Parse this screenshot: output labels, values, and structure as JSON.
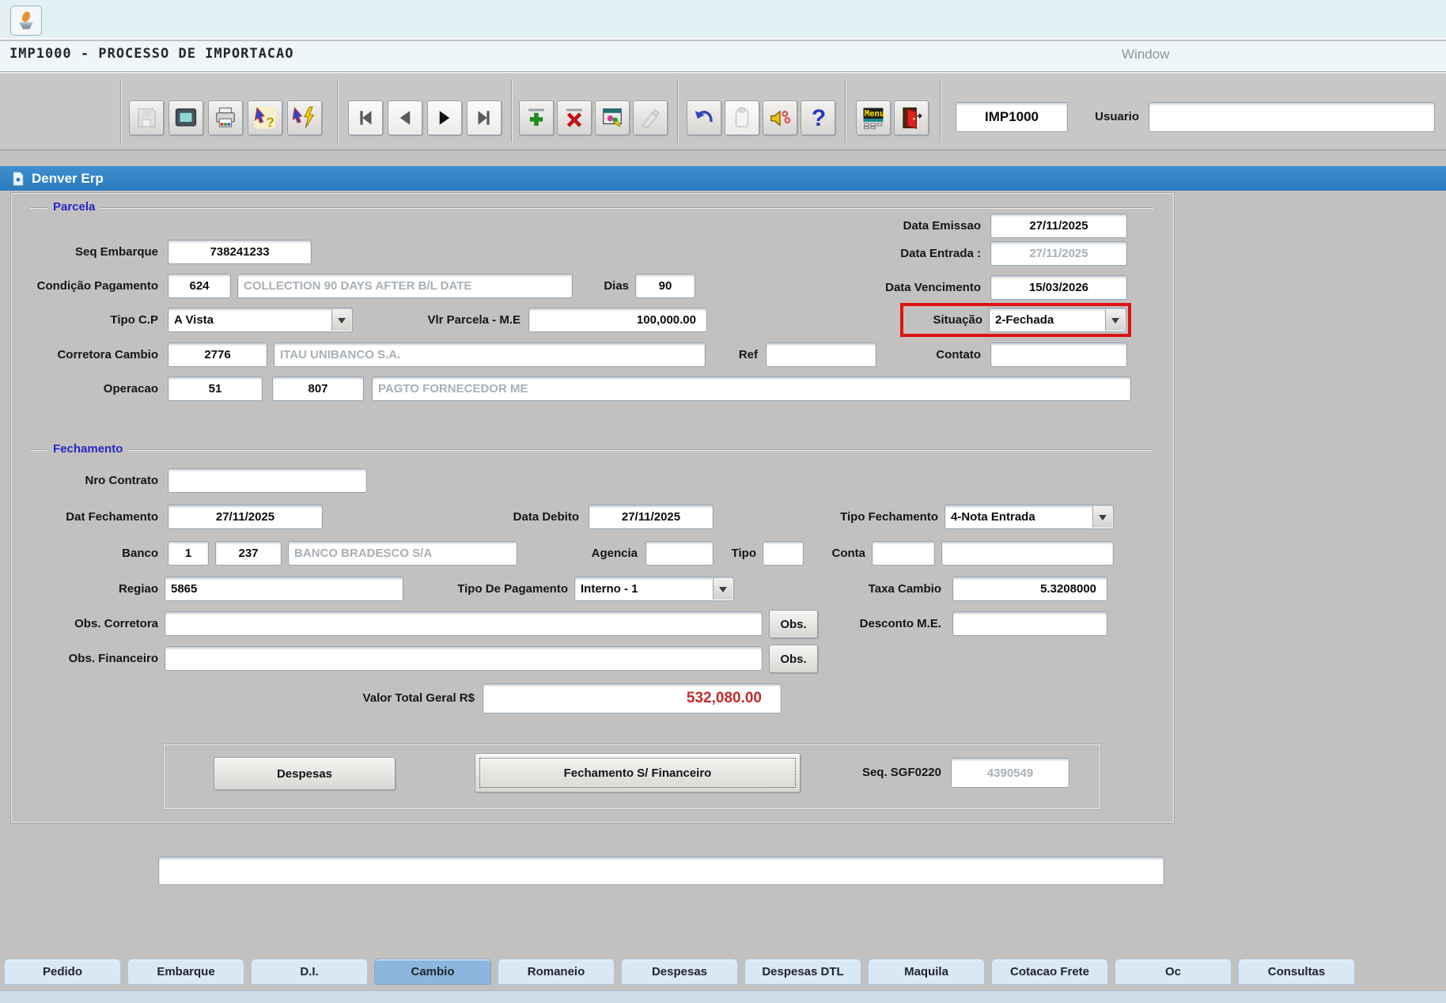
{
  "app": {
    "window_title": "IMP1000 - PROCESSO DE IMPORTACAO",
    "menu_window": "Window",
    "titlebar": "Denver Erp",
    "module_field": "IMP1000",
    "usuario": {
      "label": "Usuario",
      "value": ""
    }
  },
  "toolbar": {
    "buttons": [
      {
        "name": "save",
        "enabled": false
      },
      {
        "name": "screen",
        "enabled": true
      },
      {
        "name": "print",
        "enabled": true
      },
      {
        "name": "enter-query",
        "enabled": true
      },
      {
        "name": "execute-query",
        "enabled": true
      },
      {
        "name": "nav-first",
        "enabled": true
      },
      {
        "name": "nav-previous",
        "enabled": true
      },
      {
        "name": "nav-next",
        "enabled": true
      },
      {
        "name": "nav-last",
        "enabled": true
      },
      {
        "name": "insert-record",
        "enabled": true
      },
      {
        "name": "delete-record",
        "enabled": true
      },
      {
        "name": "list-of-values",
        "enabled": true
      },
      {
        "name": "clear-record",
        "enabled": false
      },
      {
        "name": "undo",
        "enabled": true
      },
      {
        "name": "paste",
        "enabled": false
      },
      {
        "name": "alert",
        "enabled": true
      },
      {
        "name": "help",
        "enabled": true
      },
      {
        "name": "menu",
        "enabled": true
      },
      {
        "name": "exit",
        "enabled": true
      }
    ]
  },
  "parcela": {
    "legend": "Parcela",
    "seq_embarque": {
      "label": "Seq Embarque",
      "value": "738241233"
    },
    "condicao_pagamento": {
      "label": "Condição Pagamento",
      "code": "624",
      "desc": "COLLECTION 90 DAYS AFTER B/L DATE"
    },
    "dias": {
      "label": "Dias",
      "value": "90"
    },
    "tipo_cp": {
      "label": "Tipo C.P",
      "value": "A Vista"
    },
    "vlr_parcela": {
      "label": "Vlr Parcela - M.E",
      "value": "100,000.00"
    },
    "corretora_cambio": {
      "label": "Corretora Cambio",
      "code": "2776",
      "desc": "ITAU UNIBANCO S.A."
    },
    "ref": {
      "label": "Ref",
      "value": ""
    },
    "contato": {
      "label": "Contato",
      "value": ""
    },
    "operacao": {
      "label": "Operacao",
      "code1": "51",
      "code2": "807",
      "desc": "PAGTO FORNECEDOR ME"
    },
    "data_emissao": {
      "label": "Data Emissao",
      "value": "27/11/2025"
    },
    "data_entrada": {
      "label": "Data Entrada :",
      "value": "27/11/2025"
    },
    "data_vencimento": {
      "label": "Data Vencimento",
      "value": "15/03/2026"
    },
    "situacao": {
      "label": "Situação",
      "value": "2-Fechada",
      "highlighted": true
    }
  },
  "fechamento": {
    "legend": "Fechamento",
    "nro_contrato": {
      "label": "Nro Contrato",
      "value": ""
    },
    "dat_fechamento": {
      "label": "Dat Fechamento",
      "value": "27/11/2025"
    },
    "data_debito": {
      "label": "Data Debito",
      "value": "27/11/2025"
    },
    "tipo_fechamento": {
      "label": "Tipo Fechamento",
      "value": "4-Nota Entrada"
    },
    "banco": {
      "label": "Banco",
      "code1": "1",
      "code2": "237",
      "desc": "BANCO BRADESCO S/A"
    },
    "agencia": {
      "label": "Agencia",
      "value": ""
    },
    "tipo": {
      "label": "Tipo",
      "value": ""
    },
    "conta": {
      "label": "Conta",
      "value1": "",
      "value2": ""
    },
    "regiao": {
      "label": "Regiao",
      "value": "5865"
    },
    "tipo_pagamento": {
      "label": "Tipo De Pagamento",
      "value": "Interno - 1"
    },
    "taxa_cambio": {
      "label": "Taxa Cambio",
      "value": "5.3208000"
    },
    "obs_corretora": {
      "label": "Obs. Corretora",
      "value": "",
      "button": "Obs."
    },
    "desconto_me": {
      "label": "Desconto M.E.",
      "value": ""
    },
    "obs_financeiro": {
      "label": "Obs. Financeiro",
      "value": "",
      "button": "Obs."
    },
    "valor_total": {
      "label": "Valor Total Geral R$",
      "value": "532,080.00"
    },
    "despesas_button": "Despesas",
    "fechamento_financeiro_button": "Fechamento S/ Financeiro",
    "seq_sgf": {
      "label": "Seq. SGF0220",
      "value": "4390549"
    }
  },
  "footer": {
    "note_value": ""
  },
  "tabs": [
    {
      "label": "Pedido",
      "active": false
    },
    {
      "label": "Embarque",
      "active": false
    },
    {
      "label": "D.I.",
      "active": false
    },
    {
      "label": "Cambio",
      "active": true
    },
    {
      "label": "Romaneio",
      "active": false
    },
    {
      "label": "Despesas",
      "active": false
    },
    {
      "label": "Despesas DTL",
      "active": false
    },
    {
      "label": "Maquila",
      "active": false
    },
    {
      "label": "Cotacao Frete",
      "active": false
    },
    {
      "label": "Oc",
      "active": false
    },
    {
      "label": "Consultas",
      "active": false
    }
  ],
  "colors": {
    "titlebar_blue": "#2d80c4",
    "situacao_highlight_red": "#de1212",
    "valor_total_red": "#c42b2b",
    "group_label_blue": "#2525c8",
    "tab_active_blue": "#8cb6dd"
  }
}
